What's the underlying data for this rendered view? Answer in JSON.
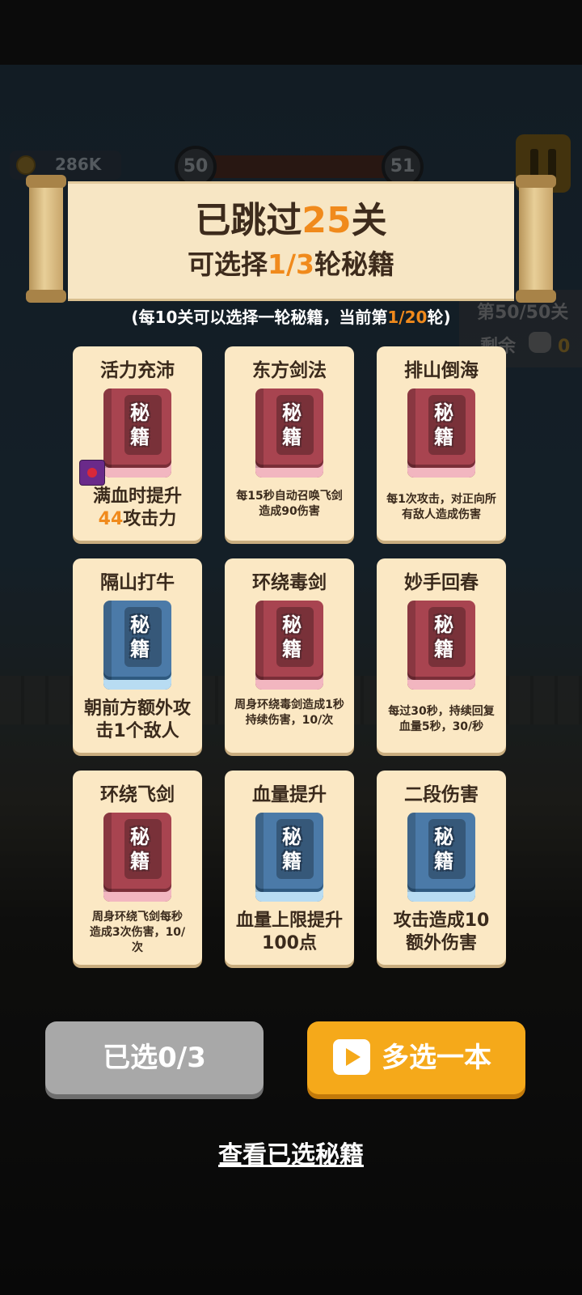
{
  "hud": {
    "coins": "286K",
    "level_current": "50",
    "level_next": "51",
    "side_progress": "第50/50关",
    "side_remaining_label": "剩余",
    "side_remaining_value": "0"
  },
  "banner": {
    "title_prefix": "已跳过",
    "title_number": "25",
    "title_suffix": "关",
    "sub_prefix": "可选择",
    "sub_number": "1/3",
    "sub_suffix": "轮秘籍"
  },
  "hint": {
    "prefix": "(每10关可以选择一轮秘籍，当前第",
    "number": "1/20",
    "suffix": "轮)"
  },
  "book_text": {
    "line1": "秘",
    "line2": "籍"
  },
  "cards": [
    {
      "name": "活力充沛",
      "color": "#a84450",
      "desc_line1": "满血时提升",
      "desc_highlight": "44",
      "desc_line2": "攻击力"
    },
    {
      "name": "东方剑法",
      "color": "#a84450",
      "desc": "每15秒自动召唤飞剑造成90伤害"
    },
    {
      "name": "排山倒海",
      "color": "#a84450",
      "desc": "每1次攻击，对正向所有敌人造成伤害"
    },
    {
      "name": "隔山打牛",
      "color": "#4b7aa8",
      "desc": "朝前方额外攻击1个敌人"
    },
    {
      "name": "环绕毒剑",
      "color": "#a84450",
      "desc": "周身环绕毒剑造成1秒持续伤害，10/次"
    },
    {
      "name": "妙手回春",
      "color": "#a84450",
      "desc": "每过30秒，持续回复血量5秒，30/秒"
    },
    {
      "name": "环绕飞剑",
      "color": "#a84450",
      "desc": "周身环绕飞剑每秒造成3次伤害，10/次"
    },
    {
      "name": "血量提升",
      "color": "#4b7aa8",
      "desc": "血量上限提升100点"
    },
    {
      "name": "二段伤害",
      "color": "#4b7aa8",
      "desc": "攻击造成10额外伤害"
    }
  ],
  "buttons": {
    "selected": "已选0/3",
    "more": "多选一本",
    "view": "查看已选秘籍"
  },
  "colors": {
    "highlight": "#f08a1c",
    "button_orange": "#f5a91a",
    "card_bg": "#fbe8c4"
  },
  "icons": {
    "coin": "coin-icon",
    "pause": "pause-icon",
    "play": "play-video-icon",
    "skull": "skull-icon"
  }
}
